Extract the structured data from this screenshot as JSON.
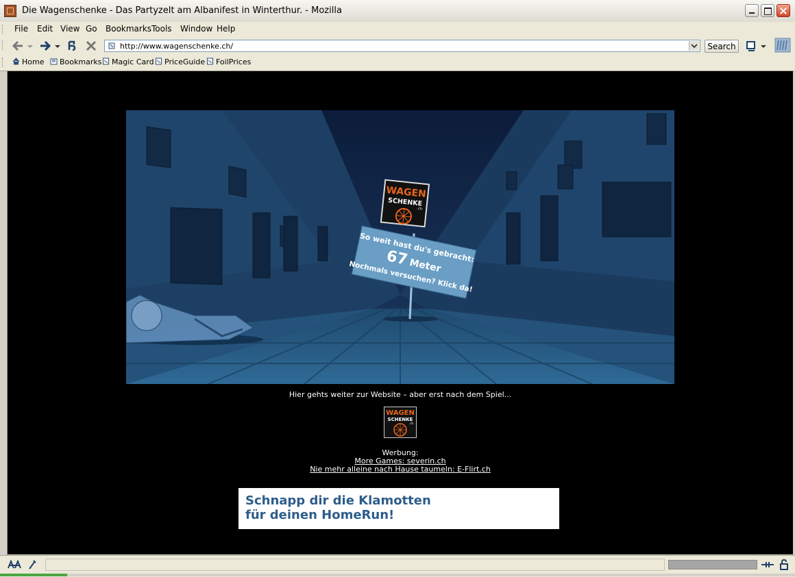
{
  "window": {
    "title": "Die Wagenschenke - Das Partyzelt am Albanifest in Winterthur. - Mozilla"
  },
  "menu": [
    "File",
    "Edit",
    "View",
    "Go",
    "Bookmarks",
    "Tools",
    "Window",
    "Help"
  ],
  "navbar": {
    "url": "http://www.wagenschenke.ch/",
    "search_label": "Search"
  },
  "personal_bar": [
    "Home",
    "Bookmarks",
    "Magic Card",
    "PriceGuide",
    "FoilPrices"
  ],
  "game": {
    "logo_line1": "WAGEN",
    "logo_line2": "SCHENKE",
    "logo_suffix": ".ch",
    "sign_line1": "So weit hast du's gebracht:",
    "sign_distance": "67",
    "sign_unit": "Meter",
    "sign_line3": "Nochmals versuchen? Klick da!"
  },
  "page": {
    "caption": "Hier gehts weiter zur Website – aber erst nach dem Spiel...",
    "ads_heading": "Werbung:",
    "ad_link1": "More Games: severin.ch",
    "ad_link2": "Nie mehr alleine nach Hause taumeln: E-Flirt.ch",
    "banner_line1": "Schnapp dir die Klamotten",
    "banner_line2": "für deinen HomeRun!"
  },
  "colors": {
    "scene_bg": "#1e4466",
    "sign_bg": "#6a9ec4",
    "logo_orange": "#e8641c",
    "banner_text": "#2d5d8a"
  }
}
